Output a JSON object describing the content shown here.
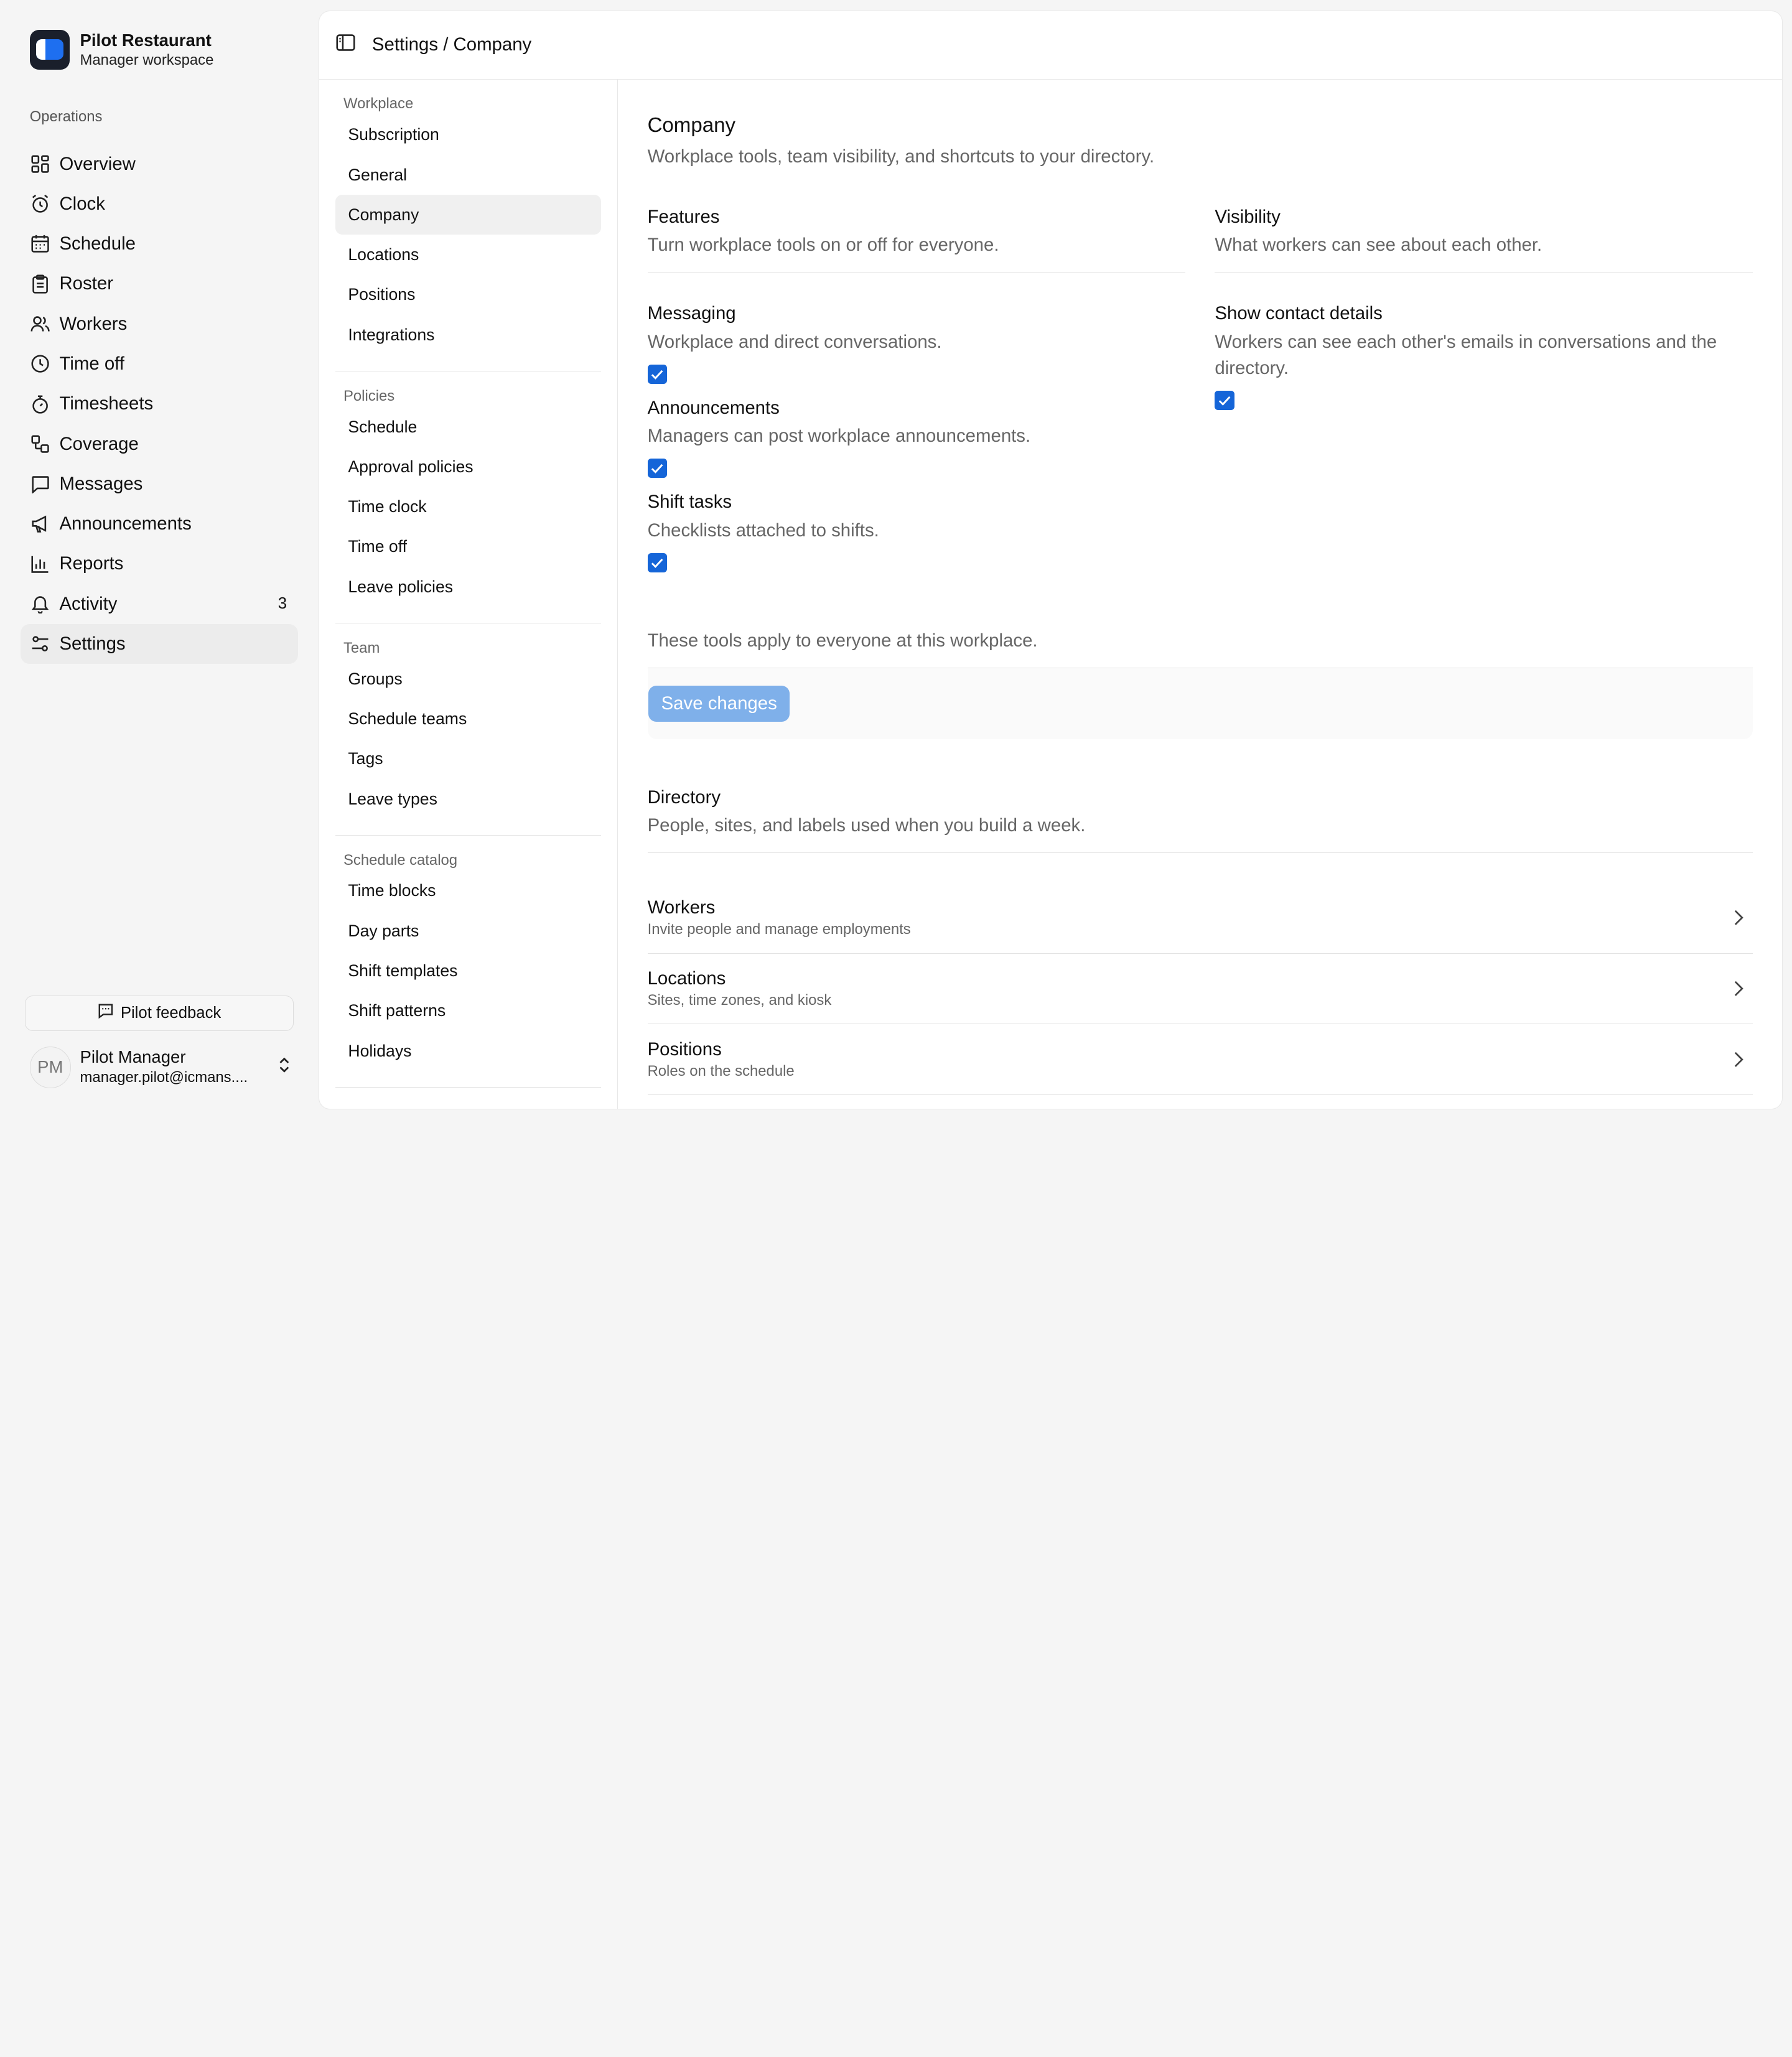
{
  "brand": {
    "name": "Pilot Restaurant",
    "subtitle": "Manager workspace"
  },
  "sidebar": {
    "heading": "Operations",
    "items": [
      {
        "label": "Overview",
        "icon": "grid-icon"
      },
      {
        "label": "Clock",
        "icon": "alarm-clock-icon"
      },
      {
        "label": "Schedule",
        "icon": "calendar-icon"
      },
      {
        "label": "Roster",
        "icon": "clipboard-icon"
      },
      {
        "label": "Workers",
        "icon": "users-icon"
      },
      {
        "label": "Time off",
        "icon": "clock-icon"
      },
      {
        "label": "Timesheets",
        "icon": "stopwatch-icon"
      },
      {
        "label": "Coverage",
        "icon": "coverage-icon"
      },
      {
        "label": "Messages",
        "icon": "message-icon"
      },
      {
        "label": "Announcements",
        "icon": "megaphone-icon"
      },
      {
        "label": "Reports",
        "icon": "bar-chart-icon"
      },
      {
        "label": "Activity",
        "icon": "bell-icon",
        "badge": "3"
      },
      {
        "label": "Settings",
        "icon": "sliders-icon",
        "active": true
      }
    ],
    "feedback_label": "Pilot feedback",
    "user": {
      "initials": "PM",
      "name": "Pilot Manager",
      "email": "manager.pilot@icmans...."
    }
  },
  "header": {
    "breadcrumb": "Settings / Company"
  },
  "subnav": {
    "groups": [
      {
        "title": "Workplace",
        "items": [
          "Subscription",
          "General",
          "Company",
          "Locations",
          "Positions",
          "Integrations"
        ]
      },
      {
        "title": "Policies",
        "items": [
          "Schedule",
          "Approval policies",
          "Time clock",
          "Time off",
          "Leave policies"
        ]
      },
      {
        "title": "Team",
        "items": [
          "Groups",
          "Schedule teams",
          "Tags",
          "Leave types"
        ]
      },
      {
        "title": "Schedule catalog",
        "items": [
          "Time blocks",
          "Day parts",
          "Shift templates",
          "Shift patterns",
          "Holidays"
        ]
      }
    ],
    "active": "Company"
  },
  "company": {
    "title": "Company",
    "description": "Workplace tools, team visibility, and shortcuts to your directory.",
    "features": {
      "title": "Features",
      "description": "Turn workplace tools on or off for everyone.",
      "options": [
        {
          "title": "Messaging",
          "description": "Workplace and direct conversations.",
          "checked": true
        },
        {
          "title": "Announcements",
          "description": "Managers can post workplace announcements.",
          "checked": true
        },
        {
          "title": "Shift tasks",
          "description": "Checklists attached to shifts.",
          "checked": true
        }
      ]
    },
    "visibility": {
      "title": "Visibility",
      "description": "What workers can see about each other.",
      "options": [
        {
          "title": "Show contact details",
          "description": "Workers can see each other's emails in conversations and the directory.",
          "checked": true
        }
      ]
    },
    "note": "These tools apply to everyone at this workplace.",
    "save_label": "Save changes"
  },
  "directory": {
    "title": "Directory",
    "description": "People, sites, and labels used when you build a week.",
    "rows": [
      {
        "title": "Workers",
        "description": "Invite people and manage employments"
      },
      {
        "title": "Locations",
        "description": "Sites, time zones, and kiosk"
      },
      {
        "title": "Positions",
        "description": "Roles on the schedule"
      }
    ]
  },
  "colors": {
    "accent": "#1565d8",
    "save_disabled": "#7fb0ea",
    "brand_bg": "#1a1f2b"
  }
}
